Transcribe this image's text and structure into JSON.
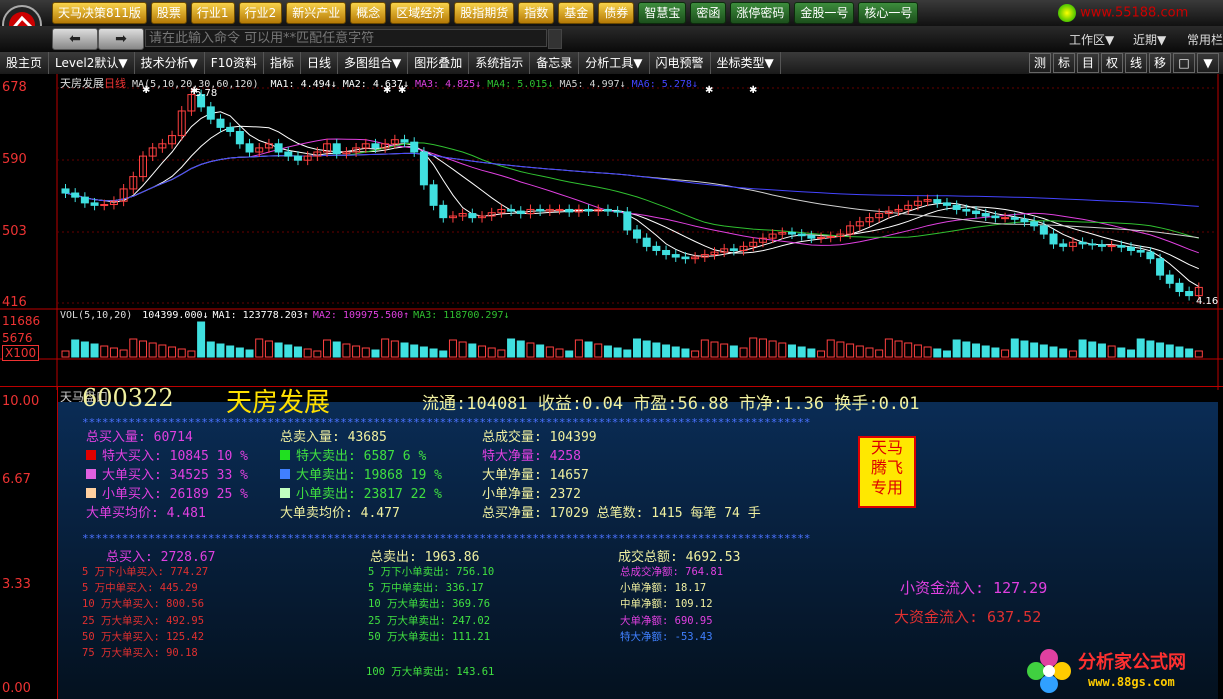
{
  "topmenu": [
    "天马决策811版",
    "股票",
    "行业1",
    "行业2",
    "新兴产业",
    "概念",
    "区域经济",
    "股指期货",
    "指数",
    "基金",
    "债券",
    "智慧宝",
    "密函",
    "涨停密码",
    "金股一号",
    "核心一号"
  ],
  "site_watermark": "www.55188.com",
  "command": {
    "placeholder": "请在此输入命令  可以用**匹配任意字符"
  },
  "right_menu": {
    "workarea": "工作区▼",
    "recent": "近期▼",
    "common": "常用栏"
  },
  "toolbar": [
    "股主页",
    "Level2默认▼",
    "技术分析▼",
    "F10资料",
    "指标",
    "日线",
    "多图组合▼",
    "图形叠加",
    "系统指示",
    "备忘录",
    "分析工具▼",
    "闪电预警",
    "坐标类型▼"
  ],
  "toolbar_right": [
    "测",
    "标",
    "目",
    "权",
    "线",
    "移",
    "□",
    "▼"
  ],
  "kline": {
    "stock_title": "天房发展",
    "period": "日线",
    "ma_header": "MA(5,10,20,30,60,120)",
    "ma": [
      {
        "label": "MA1: 4.494↓",
        "color": "#ffffff"
      },
      {
        "label": "MA2: 4.637↓",
        "color": "#ffffff"
      },
      {
        "label": "MA3: 4.825↓",
        "color": "#e040e0"
      },
      {
        "label": "MA4: 5.015↓",
        "color": "#30c030"
      },
      {
        "label": "MA5: 4.997↓",
        "color": "#d0d0d0"
      },
      {
        "label": "MA6: 5.278↓",
        "color": "#4444ff"
      }
    ],
    "price_axis": [
      "678",
      "590",
      "503",
      "416"
    ],
    "high_label": "5.78",
    "low_label": "4.16",
    "vol_header": "VOL(5,10,20)",
    "vol_values": [
      {
        "label": "104399.000↓",
        "color": "#ffffff"
      },
      {
        "label": "MA1: 123778.203↑",
        "color": "#ffffff"
      },
      {
        "label": "MA2: 109975.500↑",
        "color": "#e040e0"
      },
      {
        "label": "MA3: 118700.297↓",
        "color": "#30c030"
      }
    ],
    "vol_axis": [
      "11686",
      "5676",
      "X100"
    ]
  },
  "panel": {
    "title": "天马盘口",
    "left_axis": [
      "10.00",
      "6.67",
      "3.33",
      "0.00"
    ],
    "code": "600322",
    "name": "天房发展",
    "summary": "流通:104081 收益:0.04 市盈:56.88 市净:1.36 换手:0.01",
    "stars": "**************************************************************************************************************",
    "col1": [
      {
        "label": "总买入量: 60714",
        "color": "#e040e0"
      },
      {
        "label": "特大买入: 10845  10 %",
        "color": "#e040e0",
        "sq": "#e00000"
      },
      {
        "label": "大单买入: 34525  33 %",
        "color": "#e040e0",
        "sq": "#e060e0"
      },
      {
        "label": "小单买入: 26189  25 %",
        "color": "#e040e0",
        "sq": "#ffd0a0"
      },
      {
        "label": "大单买均价: 4.481",
        "color": "#e040e0"
      }
    ],
    "col2": [
      {
        "label": "总卖入量: 43685",
        "color": "#f0f0a0"
      },
      {
        "label": "特大卖出: 6587   6 %",
        "color": "#40e040",
        "sq": "#20e020"
      },
      {
        "label": "大单卖出: 19868  19 %",
        "color": "#40e040",
        "sq": "#4080ff"
      },
      {
        "label": "小单卖出: 23817  22 %",
        "color": "#40e040",
        "sq": "#c0ffc0"
      },
      {
        "label": "大单卖均价: 4.477",
        "color": "#f0f0a0"
      }
    ],
    "col3": [
      {
        "label": "总成交量: 104399",
        "color": "#f0f0a0"
      },
      {
        "label": "特大净量: 4258",
        "color": "#e040e0"
      },
      {
        "label": "大单净量: 14657",
        "color": "#f0f0a0"
      },
      {
        "label": "小单净量: 2372",
        "color": "#f0f0a0"
      },
      {
        "label": "总买净量: 17029 总笔数: 1415 每笔 74 手",
        "color": "#f0f0a0"
      }
    ],
    "stamp": [
      "天马",
      "腾飞",
      "专用"
    ],
    "buy_total": "总买入: 2728.67",
    "buy_rows": [
      "5  万下小单买入: 774.27",
      "5  万中单买入: 445.29",
      "10 万大单买入: 800.56",
      "25 万大单买入: 492.95",
      "50 万大单买入: 125.42",
      "75 万大单买入: 90.18"
    ],
    "sell_total": "总卖出: 1963.86",
    "sell_rows": [
      "5  万下小单卖出: 756.10",
      "5  万中单卖出: 336.17",
      "10 万大单卖出: 369.76",
      "25 万大单卖出: 247.02",
      "50 万大单卖出: 111.21",
      "100 万大单卖出: 143.61"
    ],
    "deal_total": "成交总额: 4692.53",
    "deal_rows": [
      {
        "label": "总成交净额: 764.81",
        "color": "#e040e0"
      },
      {
        "label": "小单净额: 18.17",
        "color": "#f0f0a0"
      },
      {
        "label": "中单净额: 109.12",
        "color": "#f0f0a0"
      },
      {
        "label": "大单净额: 690.95",
        "color": "#e040e0"
      },
      {
        "label": "特大净额: -53.43",
        "color": "#4080ff"
      }
    ],
    "small_flow": "小资金流入: 127.29",
    "big_flow": "大资金流入: 637.52",
    "brand": "分析家公式网",
    "brand_url": "www.88gs.com"
  }
}
